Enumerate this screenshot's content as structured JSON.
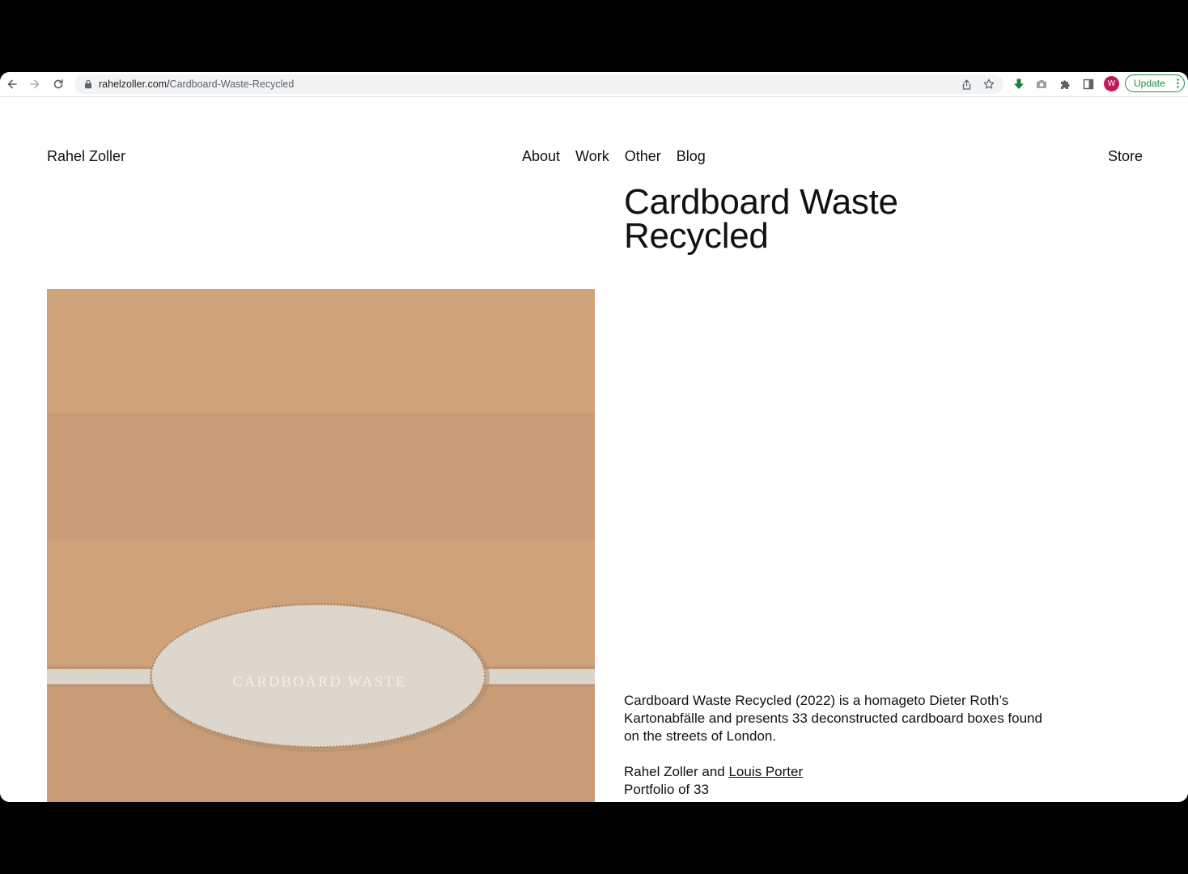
{
  "browser": {
    "url_host": "rahelzoller.com/",
    "url_path": "Cardboard-Waste-Recycled",
    "profile_initial": "W",
    "update_label": "Update",
    "colors": {
      "download_icon": "#188038",
      "profile": "#c2185b",
      "update": "#1e8e3e"
    }
  },
  "site": {
    "brand": "Rahel Zoller",
    "nav": [
      {
        "label": "About"
      },
      {
        "label": "Work"
      },
      {
        "label": "Other"
      },
      {
        "label": "Blog"
      }
    ],
    "store_label": "Store"
  },
  "project": {
    "title_line1": "Cardboard Waste",
    "title_line2": "Recycled",
    "image_text": "CARDBOARD  WASTE",
    "description": "Cardboard Waste Recycled (2022) is a homageto Dieter Roth’s Kartonabfälle and presents 33 deconstructed cardboard boxes found on the streets of London.",
    "credits_prefix": "Rahel Zoller and ",
    "credits_link": "Louis Porter",
    "edition": "Portfolio of 33"
  }
}
